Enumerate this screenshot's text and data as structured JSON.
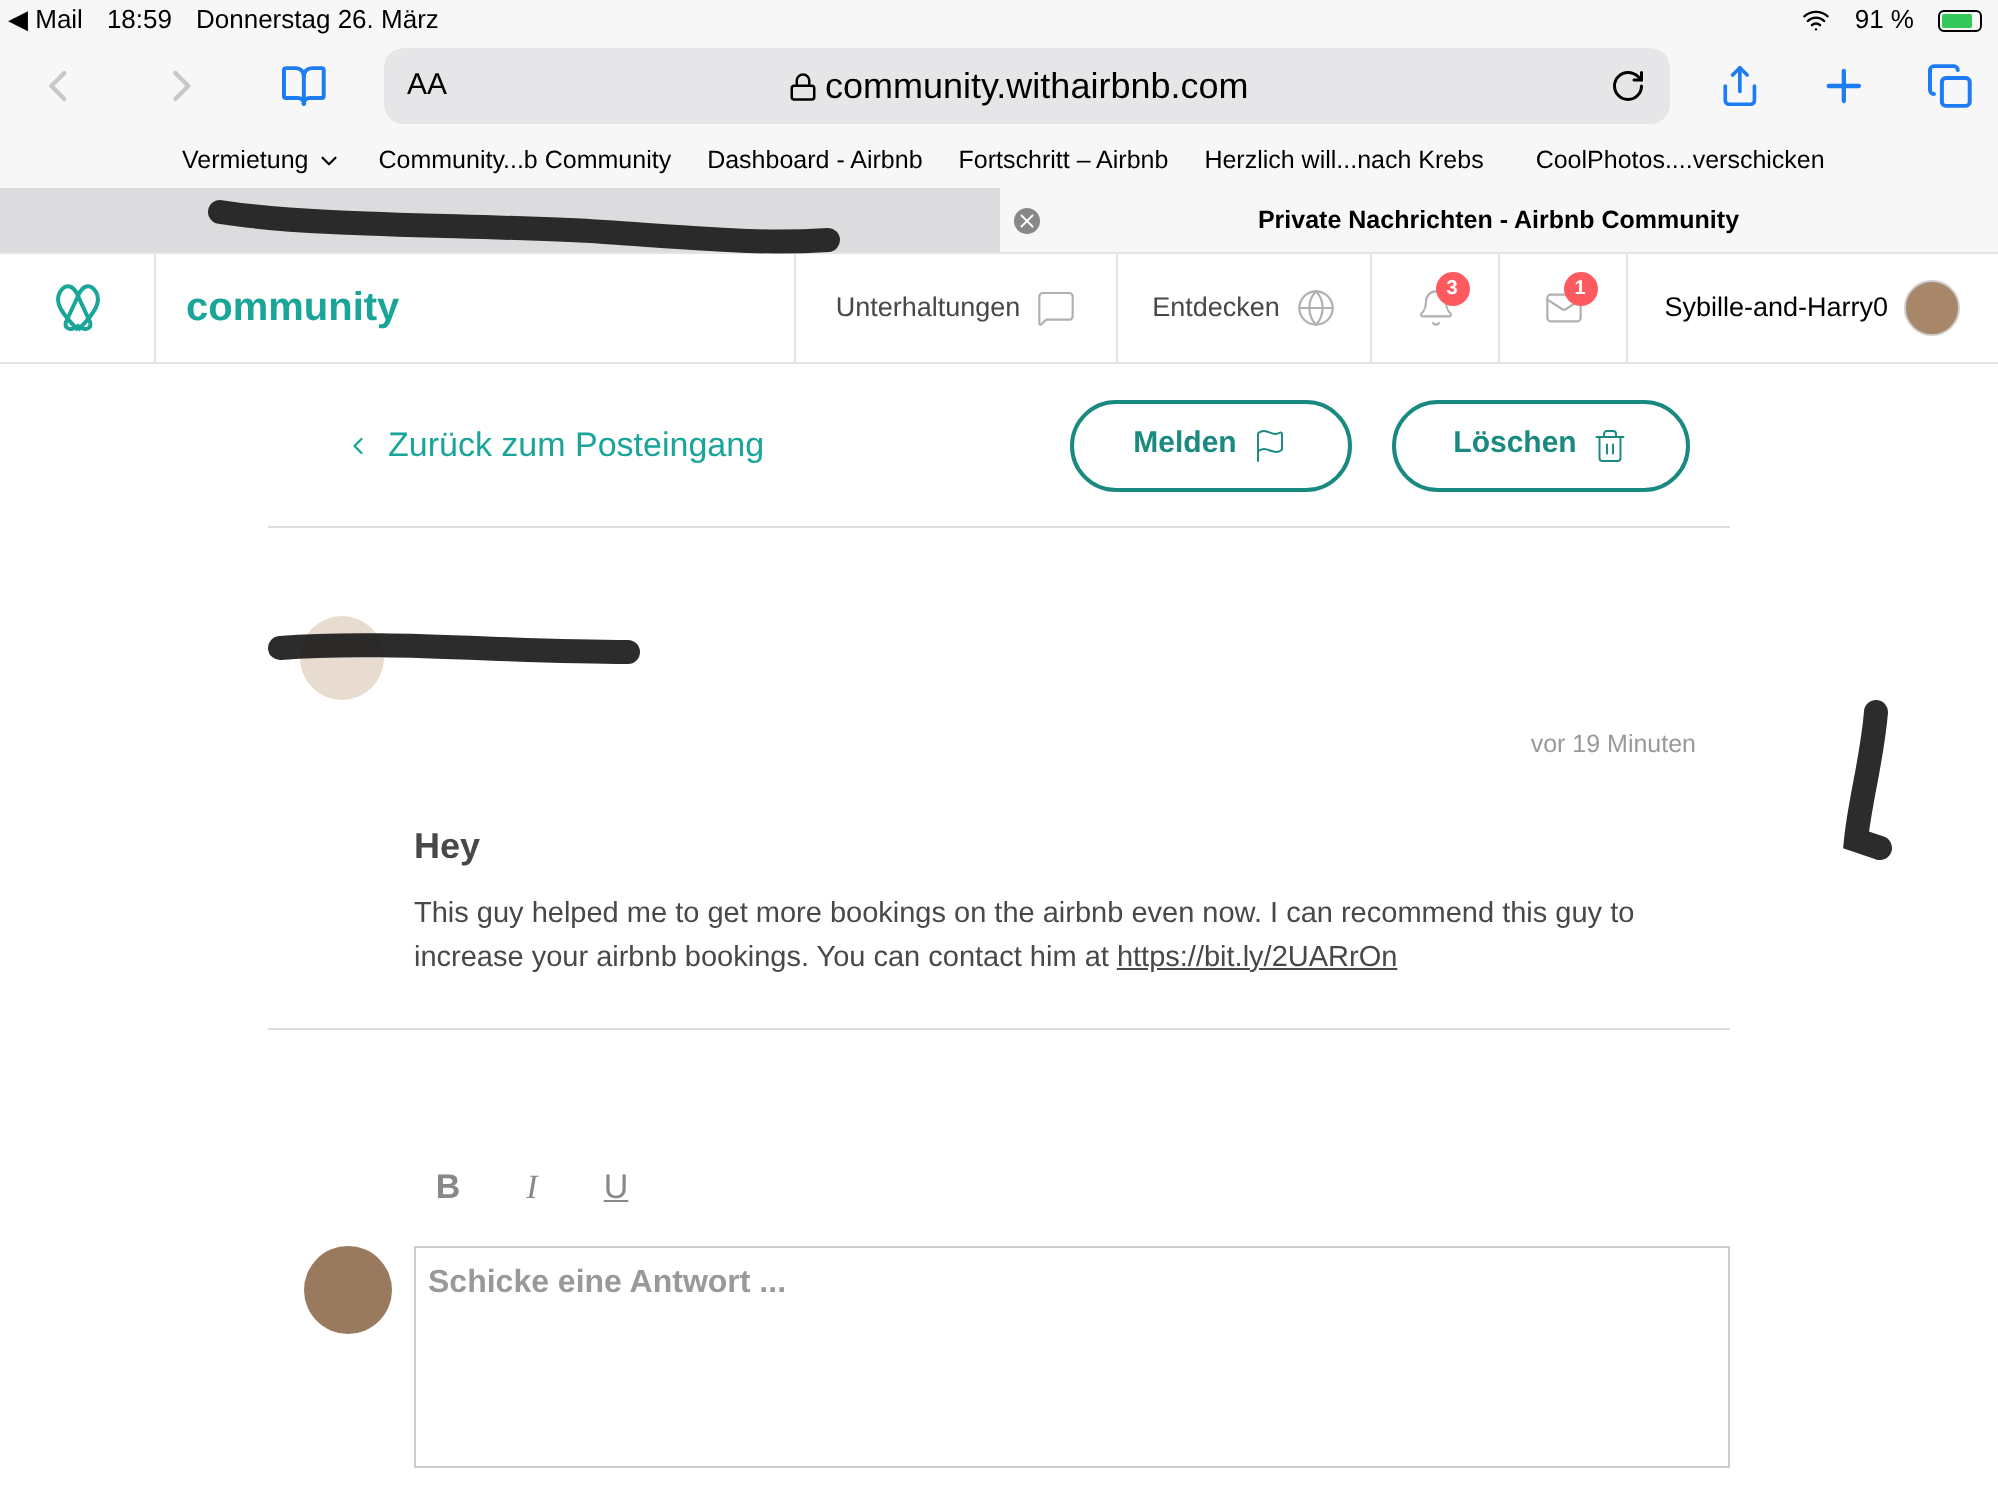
{
  "status_bar": {
    "back_app": "◀ Mail",
    "time": "18:59",
    "date": "Donnerstag 26. März",
    "battery": "91 %"
  },
  "browser": {
    "text_size": "AA",
    "url": "community.withairbnb.com"
  },
  "bookmarks": [
    {
      "label": "Vermietung",
      "kind": "folder"
    },
    {
      "label": "Community...b Community",
      "kind": "link"
    },
    {
      "label": "Dashboard - Airbnb",
      "kind": "link"
    },
    {
      "label": "Fortschritt – Airbnb",
      "kind": "link"
    },
    {
      "label": "Herzlich will...nach Krebs",
      "kind": "link"
    },
    {
      "label": "CoolPhotos....verschicken",
      "kind": "link"
    }
  ],
  "tabs": [
    {
      "selected": false
    },
    {
      "title": "Private Nachrichten - Airbnb Community",
      "selected": true
    }
  ],
  "nav": {
    "brand": "community",
    "items": [
      {
        "label": "Unterhaltungen",
        "kind": "chat"
      },
      {
        "label": "Entdecken",
        "kind": "globe"
      },
      {
        "kind": "bell",
        "badge": "3"
      },
      {
        "kind": "mail",
        "badge": "1"
      }
    ],
    "user": "Sybille-and-Harry0"
  },
  "back_link": "Zurück zum Posteingang",
  "actions": [
    {
      "label": "Melden",
      "kind": "flag"
    },
    {
      "label": "Löschen",
      "kind": "trash"
    }
  ],
  "message": {
    "time": "vor 19 Minuten",
    "subject": "Hey",
    "body": "This guy helped me to get more bookings on the airbnb even now. I can recommend this guy to increase your airbnb bookings. You can contact him at ",
    "link": "https://bit.ly/2UARrOn"
  },
  "editor": {
    "tools": [
      {
        "label": "B",
        "kind": "bold"
      },
      {
        "label": "I",
        "kind": "italic"
      },
      {
        "label": "U",
        "kind": "underline"
      }
    ],
    "placeholder": "Schicke eine Antwort ..."
  }
}
